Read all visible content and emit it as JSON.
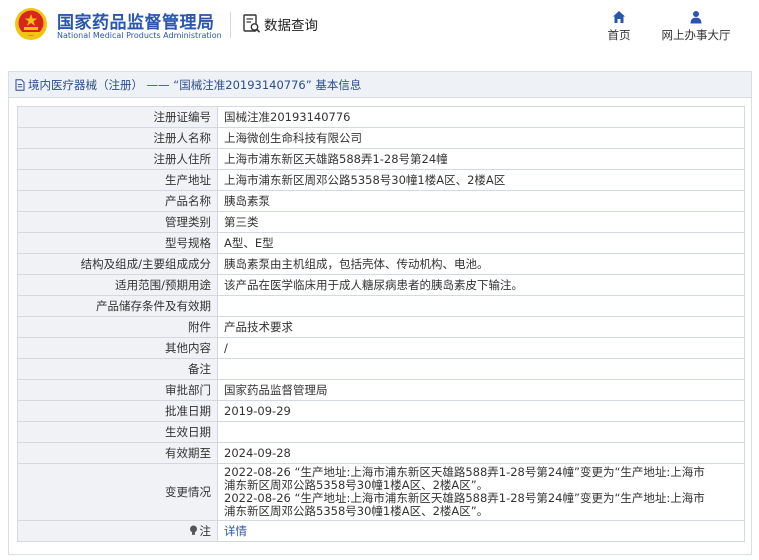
{
  "header": {
    "brand_cn": "国家药品监督管理局",
    "brand_en": "National Medical Products Administration",
    "query_label": "数据查询",
    "nav": {
      "home": "首页",
      "hall": "网上办事大厅"
    }
  },
  "panel": {
    "title": "境内医疗器械（注册） —— “国械注准20193140776” 基本信息"
  },
  "colors": {
    "brand_blue": "#2a56b0",
    "label_bg": "#f0f2f5",
    "header_bg": "#eef1f5",
    "logo_red": "#d7261d",
    "logo_gold": "#f2c30f"
  },
  "rows": [
    {
      "label": "注册证编号",
      "value": "国械注准20193140776"
    },
    {
      "label": "注册人名称",
      "value": "上海微创生命科技有限公司"
    },
    {
      "label": "注册人住所",
      "value": "上海市浦东新区天雄路588弄1-28号第24幢"
    },
    {
      "label": "生产地址",
      "value": "上海市浦东新区周邓公路5358号30幢1楼A区、2楼A区"
    },
    {
      "label": "产品名称",
      "value": "胰岛素泵"
    },
    {
      "label": "管理类别",
      "value": "第三类"
    },
    {
      "label": "型号规格",
      "value": "A型、E型"
    },
    {
      "label": "结构及组成/主要组成成分",
      "value": "胰岛素泵由主机组成，包括壳体、传动机构、电池。"
    },
    {
      "label": "适用范围/预期用途",
      "value": "该产品在医学临床用于成人糖尿病患者的胰岛素皮下输注。"
    },
    {
      "label": "产品储存条件及有效期",
      "value": ""
    },
    {
      "label": "附件",
      "value": "产品技术要求"
    },
    {
      "label": "其他内容",
      "value": "/"
    },
    {
      "label": "备注",
      "value": ""
    },
    {
      "label": "审批部门",
      "value": "国家药品监督管理局"
    },
    {
      "label": "批准日期",
      "value": "2019-09-29"
    },
    {
      "label": "生效日期",
      "value": ""
    },
    {
      "label": "有效期至",
      "value": "2024-09-28"
    }
  ],
  "change_row": {
    "label": "变更情况",
    "lines": [
      "2022-08-26 “生产地址:上海市浦东新区天雄路588弄1-28号第24幢”变更为“生产地址:上海市",
      "浦东新区周邓公路5358号30幢1楼A区、2楼A区”。",
      "2022-08-26 “生产地址:上海市浦东新区天雄路588弄1-28号第24幢”变更为“生产地址:上海市",
      "浦东新区周邓公路5358号30幢1楼A区、2楼A区”。"
    ]
  },
  "note_row": {
    "label": "注",
    "link": "详情"
  }
}
